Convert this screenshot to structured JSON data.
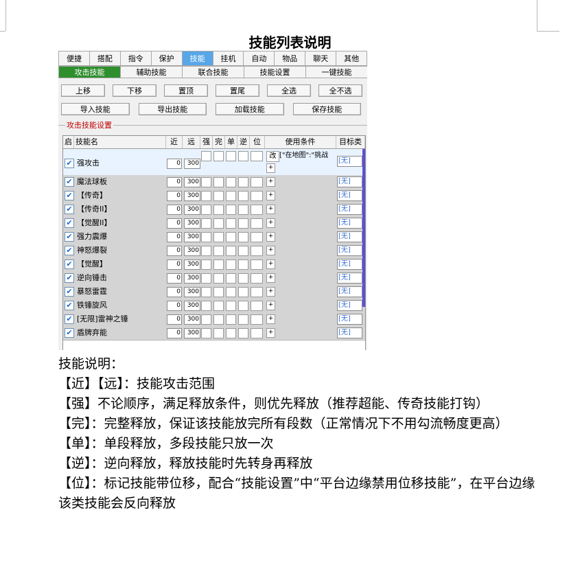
{
  "doc_title": "技能列表说明",
  "tabs": [
    {
      "label": "便捷",
      "active": false
    },
    {
      "label": "搭配",
      "active": false
    },
    {
      "label": "指令",
      "active": false
    },
    {
      "label": "保护",
      "active": false
    },
    {
      "label": "技能",
      "active": true
    },
    {
      "label": "挂机",
      "active": false
    },
    {
      "label": "自动",
      "active": false
    },
    {
      "label": "物品",
      "active": false
    },
    {
      "label": "聊天",
      "active": false
    },
    {
      "label": "其他",
      "active": false
    }
  ],
  "subtabs": [
    {
      "label": "攻击技能",
      "active": true
    },
    {
      "label": "辅助技能",
      "active": false
    },
    {
      "label": "联合技能",
      "active": false
    },
    {
      "label": "技能设置",
      "active": false
    },
    {
      "label": "一键技能",
      "active": false
    }
  ],
  "buttons_row1": [
    "上移",
    "下移",
    "置顶",
    "置尾",
    "全选",
    "全不选"
  ],
  "buttons_row2": [
    "导入技能",
    "导出技能",
    "加载技能",
    "保存技能"
  ],
  "group_label": "攻击技能设置",
  "table": {
    "headers": [
      "启",
      "技能名",
      "近",
      "远",
      "强",
      "完",
      "单",
      "逆",
      "位",
      "使用条件",
      "目标类别"
    ],
    "first_row_condition": "[\"在地图\":\"挑战",
    "first_row_edit": "改",
    "plus": "+",
    "rows": [
      {
        "enabled": true,
        "name": "强攻击",
        "near": "0",
        "far": "300",
        "target": "[无]"
      },
      {
        "enabled": true,
        "name": "魔法球板",
        "near": "0",
        "far": "300",
        "target": "[无]"
      },
      {
        "enabled": true,
        "name": "【传奇】",
        "near": "0",
        "far": "300",
        "target": "[无]"
      },
      {
        "enabled": true,
        "name": "【传奇II】",
        "near": "0",
        "far": "300",
        "target": "[无]"
      },
      {
        "enabled": true,
        "name": "【觉醒II】",
        "near": "0",
        "far": "300",
        "target": "[无]"
      },
      {
        "enabled": true,
        "name": "强力震爆",
        "near": "0",
        "far": "300",
        "target": "[无]"
      },
      {
        "enabled": true,
        "name": "神怒爆裂",
        "near": "0",
        "far": "300",
        "target": "[无]"
      },
      {
        "enabled": true,
        "name": "【觉醒】",
        "near": "0",
        "far": "300",
        "target": "[无]"
      },
      {
        "enabled": true,
        "name": "逆向锤击",
        "near": "0",
        "far": "300",
        "target": "[无]"
      },
      {
        "enabled": true,
        "name": "暴怒雷霆",
        "near": "0",
        "far": "300",
        "target": "[无]"
      },
      {
        "enabled": true,
        "name": "铁锤旋风",
        "near": "0",
        "far": "300",
        "target": "[无]"
      },
      {
        "enabled": true,
        "name": "[无限]雷神之锤",
        "near": "0",
        "far": "300",
        "target": "[无]"
      },
      {
        "enabled": true,
        "name": "盾牌弃能",
        "near": "0",
        "far": "300",
        "target": "[无]"
      }
    ]
  },
  "notes": [
    "技能说明：",
    "【近】【远】：技能攻击范围",
    "【强】不论顺序，满足释放条件，则优先释放（推荐超能、传奇技能打钩）",
    "【完】：完整释放，保证该技能放完所有段数（正常情况下不用勾流畅度更高）",
    "【单】：单段释放，多段技能只放一次",
    "【逆】：逆向释放，释放技能时先转身再释放",
    "【位】：标记技能带位移，配合“技能设置”中“平台边缘禁用位移技能”，在平台边缘该类技能会反向释放"
  ]
}
